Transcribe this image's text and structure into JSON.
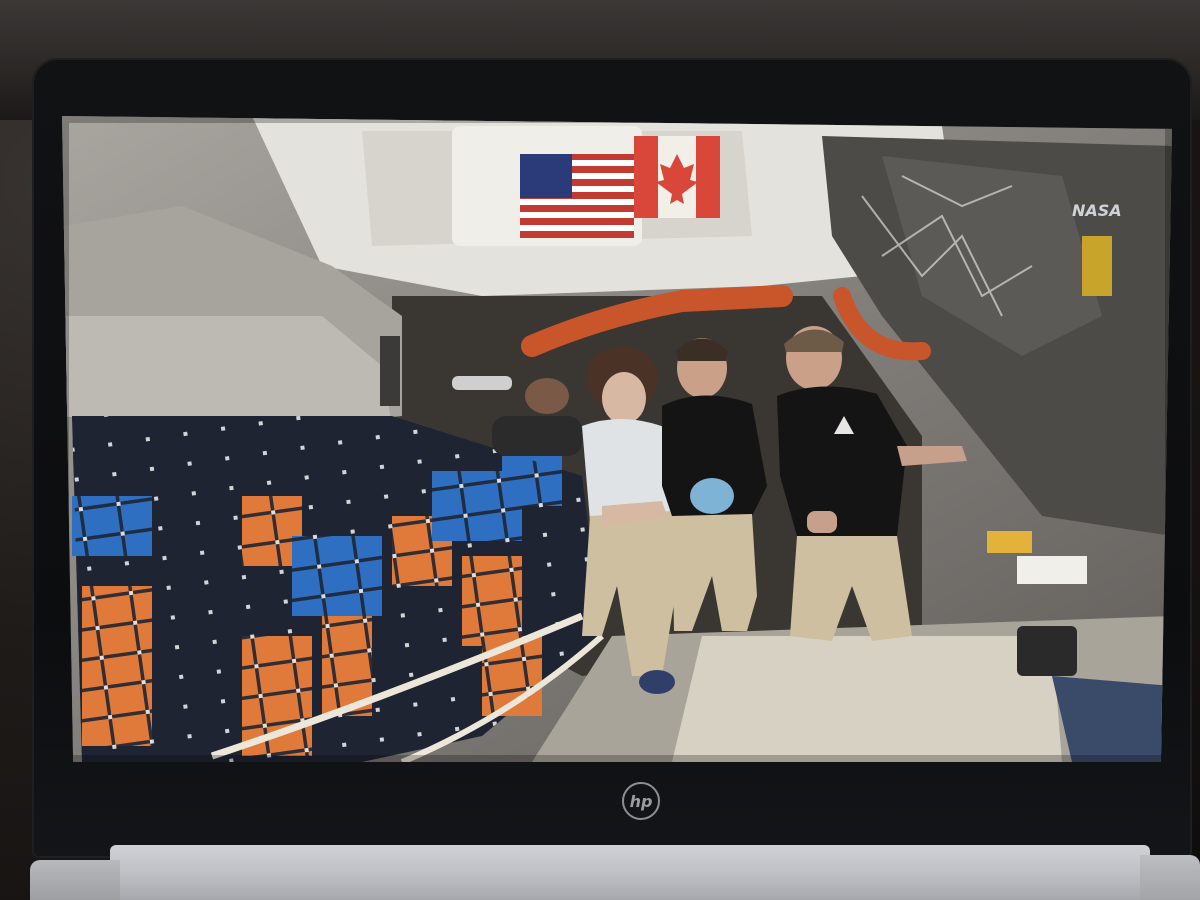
{
  "device": {
    "brand_logo": "hp"
  },
  "screen": {
    "watermark": "NASA"
  },
  "colors": {
    "flag_red": "#c23b33",
    "flag_blue": "#2b3b7a",
    "cargo_orange": "#e07a3a",
    "cargo_blue": "#2f6fc2",
    "net_dark": "#1e2432",
    "shirt_black": "#141414",
    "pants_khaki": "#cdbf9f",
    "hose_orange": "#c9552b"
  }
}
